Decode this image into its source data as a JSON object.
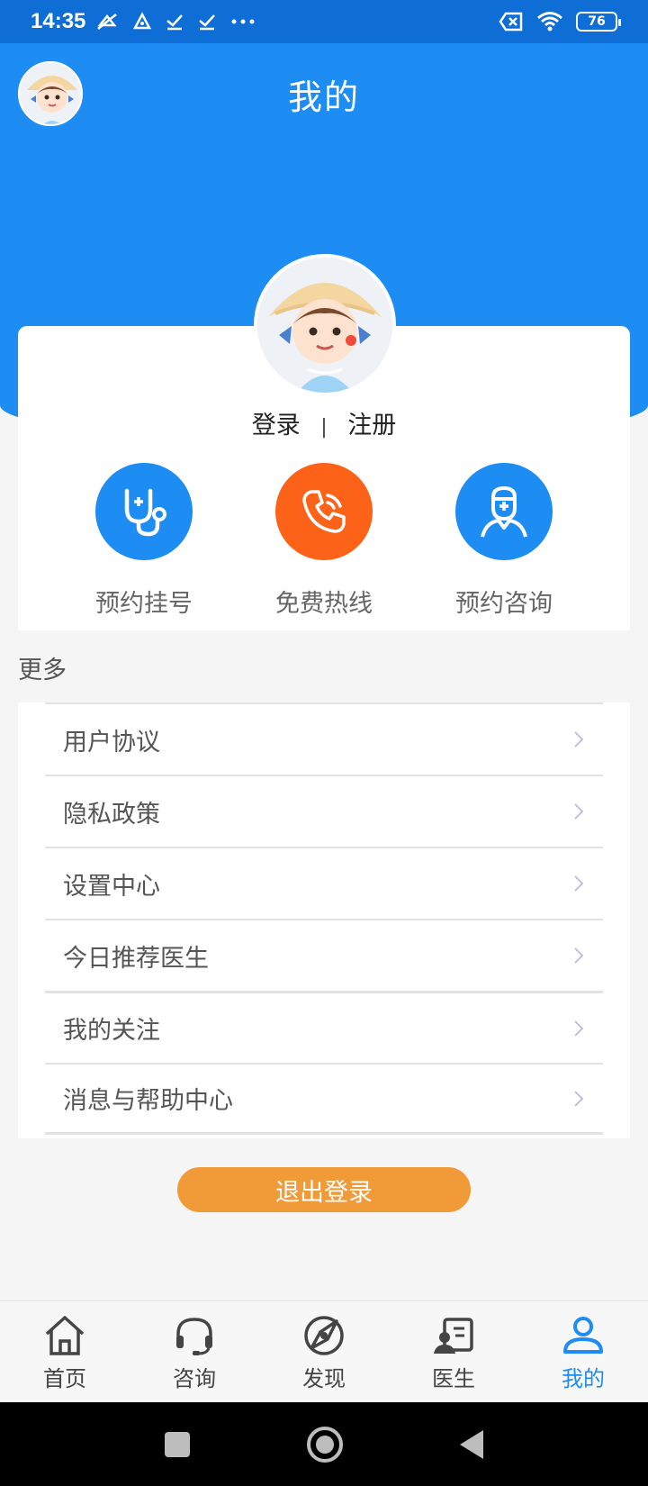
{
  "status_bar": {
    "time": "14:35",
    "battery": "76",
    "left_icons": [
      "mute-icon",
      "sync-icon",
      "check-icon",
      "check-icon",
      "more-dots-icon"
    ],
    "right_icons": [
      "no-sim-icon",
      "wifi-icon",
      "battery-icon"
    ]
  },
  "header": {
    "title": "我的"
  },
  "profile": {
    "login_label": "登录",
    "separator": "|",
    "register_label": "注册"
  },
  "quick_actions": [
    {
      "label": "预约挂号",
      "icon": "stethoscope-icon",
      "color": "#1d8cf3"
    },
    {
      "label": "免费热线",
      "icon": "phone-icon",
      "color": "#fd6318"
    },
    {
      "label": "预约咨询",
      "icon": "doctor-icon",
      "color": "#1d8cf3"
    }
  ],
  "more": {
    "title": "更多",
    "items": [
      {
        "label": "用户协议"
      },
      {
        "label": "隐私政策"
      },
      {
        "label": "设置中心"
      },
      {
        "label": "今日推荐医生"
      },
      {
        "label": "我的关注"
      },
      {
        "label": "消息与帮助中心"
      }
    ]
  },
  "logout": {
    "label": "退出登录",
    "color": "#f19a38"
  },
  "tabbar": {
    "active_color": "#1d8cf3",
    "items": [
      {
        "label": "首页",
        "icon": "home-icon"
      },
      {
        "label": "咨询",
        "icon": "headset-icon"
      },
      {
        "label": "发现",
        "icon": "compass-icon"
      },
      {
        "label": "医生",
        "icon": "doctor-card-icon"
      },
      {
        "label": "我的",
        "icon": "user-icon",
        "active": true
      }
    ]
  },
  "colors": {
    "primary": "#1d8cf3",
    "status_bar": "#0f6ed6",
    "hotline": "#fd6318"
  }
}
